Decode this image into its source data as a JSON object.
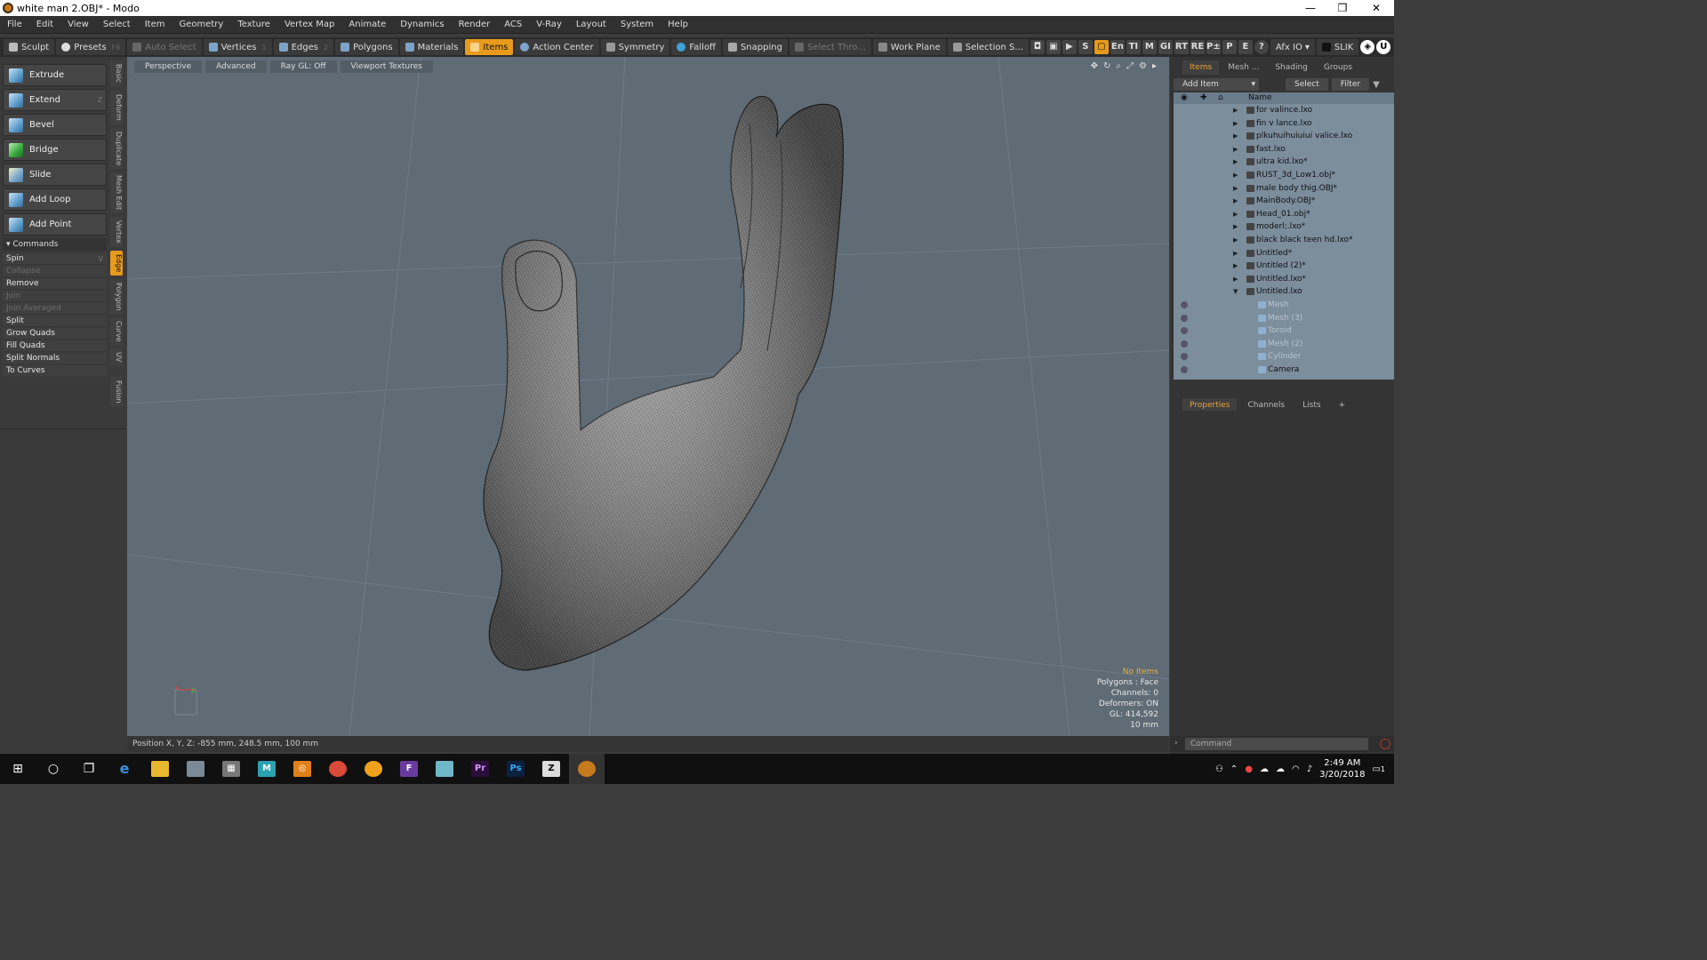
{
  "window": {
    "title": "white man 2.OBJ* - Modo",
    "min": "—",
    "max": "❐",
    "close": "✕"
  },
  "menu": [
    "File",
    "Edit",
    "View",
    "Select",
    "Item",
    "Geometry",
    "Texture",
    "Vertex Map",
    "Animate",
    "Dynamics",
    "Render",
    "ACS",
    "V-Ray",
    "Layout",
    "System",
    "Help"
  ],
  "toolbar": {
    "sculpt": "Sculpt",
    "presets": "Presets",
    "presets_key": "F6",
    "auto_select": "Auto Select",
    "vertices": "Vertices",
    "vertices_key": "1",
    "edges": "Edges",
    "edges_key": "2",
    "polygons": "Polygons",
    "materials": "Materials",
    "items": "Items",
    "action_center": "Action Center",
    "symmetry": "Symmetry",
    "falloff": "Falloff",
    "snapping": "Snapping",
    "select_thru": "Select Thro...",
    "work_plane": "Work Plane",
    "selection_sets": "Selection S...",
    "icon_s": "S",
    "icon_en": "En",
    "icon_ti": "TI",
    "icon_m": "M",
    "icon_gi": "GI",
    "icon_rt": "RT",
    "icon_re": "RE",
    "icon_pp": "P±",
    "icon_p": "P",
    "icon_e": "E",
    "icon_q": "?",
    "afx": "Afx IO",
    "slik": "SLIK"
  },
  "tools": [
    {
      "label": "Extrude",
      "key": ""
    },
    {
      "label": "Extend",
      "key": "Z"
    },
    {
      "label": "Bevel",
      "key": ""
    },
    {
      "label": "Bridge",
      "key": ""
    },
    {
      "label": "Slide",
      "key": ""
    },
    {
      "label": "Add Loop",
      "key": ""
    },
    {
      "label": "Add Point",
      "key": ""
    }
  ],
  "commands_header": "Commands",
  "commands": [
    {
      "label": "Spin",
      "key": "V"
    },
    {
      "label": "Collapse"
    },
    {
      "label": "Remove"
    },
    {
      "label": "Join"
    },
    {
      "label": "Join Averaged"
    },
    {
      "label": "Split"
    },
    {
      "label": "Grow Quads"
    },
    {
      "label": "Fill Quads"
    },
    {
      "label": "Split Normals"
    },
    {
      "label": "To Curves"
    }
  ],
  "side_tabs": [
    "Basic",
    "Deform",
    "Duplicate",
    "Mesh Edit",
    "Vertex",
    "Edge",
    "Polygon",
    "Curve",
    "UV",
    "Fusion"
  ],
  "viewport": {
    "perspective": "Perspective",
    "advanced": "Advanced",
    "raygl": "Ray GL: Off",
    "textures": "Viewport Textures",
    "info": {
      "no_items": "No Items",
      "polygons": "Polygons : Face",
      "channels": "Channels: 0",
      "deformers": "Deformers: ON",
      "gl": "GL: 414,592",
      "scale": "10 mm"
    }
  },
  "status": {
    "position": "Position X, Y, Z:   -855 mm, 248.5 mm, 100 mm"
  },
  "right_tabs": [
    "Items",
    "Mesh ...",
    "Shading",
    "Groups"
  ],
  "items_bar": {
    "add_item": "Add Item",
    "select": "Select",
    "filter": "Filter"
  },
  "items_header": "Name",
  "items": [
    {
      "name": "for valince.lxo"
    },
    {
      "name": "fin v lance.lxo"
    },
    {
      "name": "plkuhuihuiuiui valice.lxo"
    },
    {
      "name": "fast.lxo"
    },
    {
      "name": "ultra kid.lxo*"
    },
    {
      "name": "RUST_3d_Low1.obj*"
    },
    {
      "name": "male body thig.OBJ*"
    },
    {
      "name": "MainBody.OBJ*"
    },
    {
      "name": "Head_01.obj*"
    },
    {
      "name": "moderl;.lxo*"
    },
    {
      "name": "black black teen hd.lxo*"
    },
    {
      "name": "Untitled*"
    },
    {
      "name": "Untitled (2)*"
    },
    {
      "name": "Untitled.lxo*"
    },
    {
      "name": "Untitled.lxo"
    },
    {
      "name": "Mesh"
    },
    {
      "name": "Mesh (3)"
    },
    {
      "name": "Toroid"
    },
    {
      "name": "Mesh (2)"
    },
    {
      "name": "Cylinder"
    },
    {
      "name": "Camera"
    }
  ],
  "props_tabs": [
    "Properties",
    "Channels",
    "Lists",
    "+"
  ],
  "command_placeholder": "Command",
  "taskbar": {
    "time": "2:49 AM",
    "date": "3/20/2018",
    "notify": "1"
  },
  "colors": {
    "accent": "#e89a1c",
    "viewport": "#5f6b75",
    "items_bg": "#7c8d9c"
  }
}
